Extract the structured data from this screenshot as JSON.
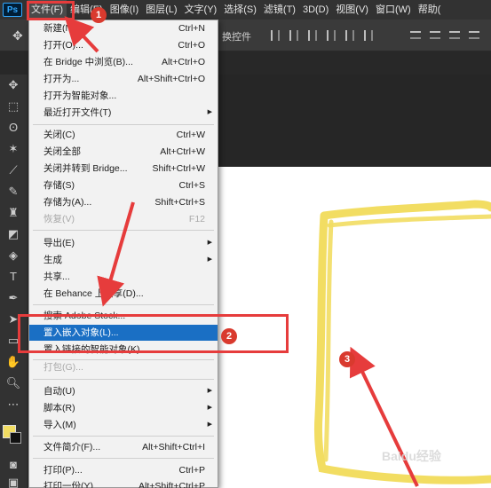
{
  "menubar": {
    "logo": "Ps",
    "items": [
      "文件(F)",
      "编辑(E)",
      "图像(I)",
      "图层(L)",
      "文字(Y)",
      "选择(S)",
      "滤镜(T)",
      "3D(D)",
      "视图(V)",
      "窗口(W)",
      "帮助("
    ]
  },
  "optionsbar": {
    "label": "换控件"
  },
  "file_menu": {
    "items": [
      {
        "label": "新建(N)...",
        "shortcut": "Ctrl+N"
      },
      {
        "label": "打开(O)...",
        "shortcut": "Ctrl+O"
      },
      {
        "label": "在 Bridge 中浏览(B)...",
        "shortcut": "Alt+Ctrl+O"
      },
      {
        "label": "打开为...",
        "shortcut": "Alt+Shift+Ctrl+O"
      },
      {
        "label": "打开为智能对象...",
        "shortcut": ""
      },
      {
        "label": "最近打开文件(T)",
        "shortcut": ""
      },
      {
        "label": "关闭(C)",
        "shortcut": "Ctrl+W"
      },
      {
        "label": "关闭全部",
        "shortcut": "Alt+Ctrl+W"
      },
      {
        "label": "关闭并转到 Bridge...",
        "shortcut": "Shift+Ctrl+W"
      },
      {
        "label": "存储(S)",
        "shortcut": "Ctrl+S"
      },
      {
        "label": "存储为(A)...",
        "shortcut": "Shift+Ctrl+S"
      },
      {
        "label": "恢复(V)",
        "shortcut": "F12"
      },
      {
        "label": "导出(E)",
        "shortcut": ""
      },
      {
        "label": "生成",
        "shortcut": ""
      },
      {
        "label": "共享...",
        "shortcut": ""
      },
      {
        "label": "在 Behance 上共享(D)...",
        "shortcut": ""
      },
      {
        "label": "搜索 Adobe Stock...",
        "shortcut": ""
      },
      {
        "label": "置入嵌入对象(L)...",
        "shortcut": ""
      },
      {
        "label": "置入链接的智能对象(K)...",
        "shortcut": ""
      },
      {
        "label": "打包(G)...",
        "shortcut": ""
      },
      {
        "label": "自动(U)",
        "shortcut": ""
      },
      {
        "label": "脚本(R)",
        "shortcut": ""
      },
      {
        "label": "导入(M)",
        "shortcut": ""
      },
      {
        "label": "文件简介(F)...",
        "shortcut": "Alt+Shift+Ctrl+I"
      },
      {
        "label": "打印(P)...",
        "shortcut": "Ctrl+P"
      },
      {
        "label": "打印一份(Y)",
        "shortcut": "Alt+Shift+Ctrl+P"
      }
    ]
  },
  "annotations": {
    "badge1": "1",
    "badge2": "2",
    "badge3": "3"
  },
  "watermark": "Baidu经验",
  "colors": {
    "highlight": "#1a6fc4",
    "annotation_red": "#e63c3c",
    "frame_yellow": "#f2dd62",
    "foreground_swatch": "#f2dd62"
  }
}
